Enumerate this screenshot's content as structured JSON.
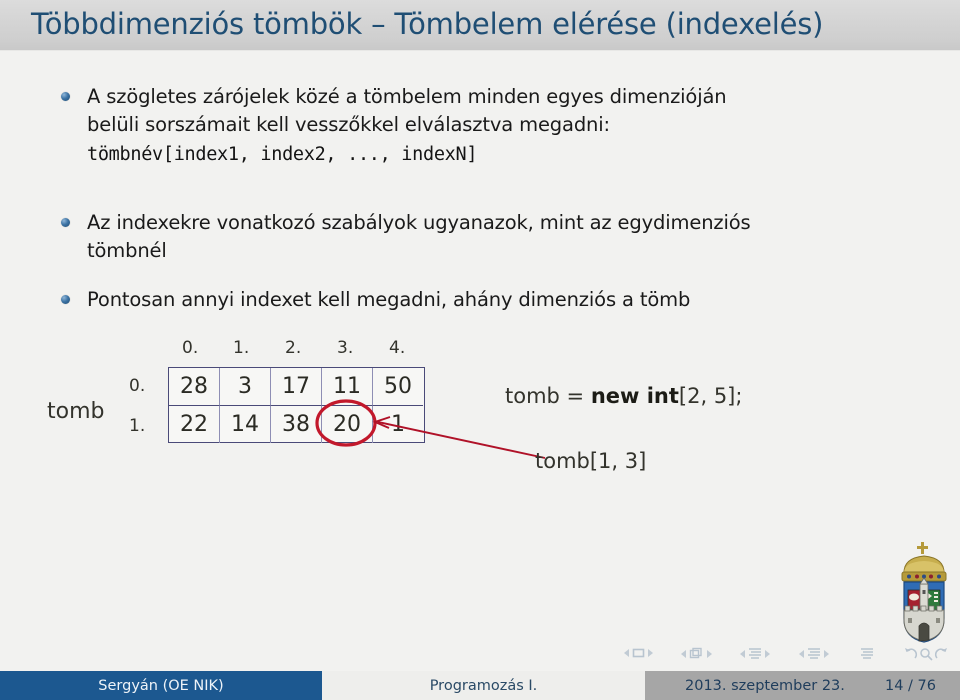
{
  "slide": {
    "title": "Többdimenziós tömbök – Tömbelem elérése (indexelés)",
    "title_color": "#1f4e74",
    "background": "#f2f2f0"
  },
  "bullets": [
    {
      "id": "bullet-1",
      "line1": "A szögletes zárójelek közé a tömbelem minden egyes dimenzióján",
      "line2": "belüli sorszámait kell vesszőkkel elválasztva megadni:",
      "code": "tömbnév[index1, index2, ..., indexN]"
    },
    {
      "id": "bullet-2",
      "line1": "Az indexekre vonatkozó szabályok ugyanazok, mint az egydimenziós",
      "line2": "tömbnél"
    },
    {
      "id": "bullet-3",
      "line1": "Pontosan annyi indexet kell megadni, ahány dimenziós a tömb"
    }
  ],
  "figure": {
    "array_name": "tomb",
    "column_headers": [
      "0.",
      "1.",
      "2.",
      "3.",
      "4."
    ],
    "row_headers": [
      "0.",
      "1."
    ],
    "rows": [
      [
        "28",
        "3",
        "17",
        "11",
        "50"
      ],
      [
        "22",
        "14",
        "38",
        "20",
        "1"
      ]
    ],
    "highlight": {
      "row": 1,
      "col": 3,
      "value": "20",
      "color": "#c2182b"
    },
    "code_declaration_pre": "tomb = ",
    "code_declaration_bold": "new int",
    "code_declaration_post": "[2, 5];",
    "code_access": "tomb[1, 3]",
    "grid_border_color": "#4a4a78"
  },
  "navigation": {
    "items": [
      "nav-frame-prev",
      "nav-frame",
      "nav-frame-next",
      "nav-subsection-prev",
      "nav-subsection",
      "nav-subsection-next",
      "nav-section-prev",
      "nav-section",
      "nav-section-next",
      "nav-part-prev",
      "nav-part",
      "nav-part-next",
      "nav-doc",
      "nav-back",
      "nav-search",
      "nav-forward"
    ]
  },
  "footer": {
    "author": "Sergyán  (OE NIK)",
    "course": "Programozás I.",
    "date": "2013. szeptember 23.",
    "page": "14 / 76",
    "author_bg": "#1c5890",
    "middle_bg": "#eeeeec",
    "right_bg": "#a6a6a6"
  },
  "logo": {
    "name": "obuda-university-coat-of-arms"
  }
}
